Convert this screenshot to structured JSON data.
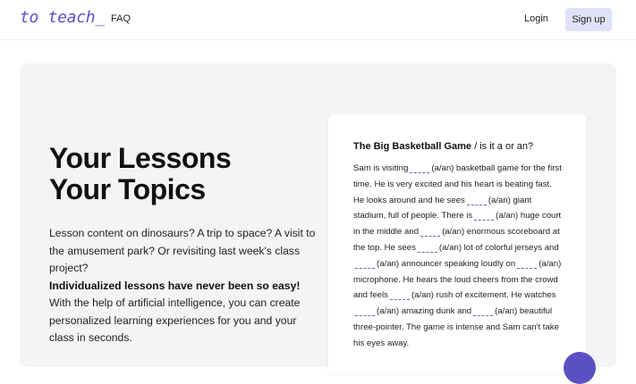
{
  "nav": {
    "logo": "to teach_",
    "faq": "FAQ",
    "login": "Login",
    "signup": "Sign up"
  },
  "hero": {
    "title_line1": "Your Lessons",
    "title_line2": "Your Topics",
    "desc_intro": "Lesson content on dinosaurs? A trip to space? A visit to the amusement park? Or revisiting last week's class project?",
    "desc_bold": "Individualized lessons have never been so easy!",
    "desc_rest": "With the help of artificial intelligence, you can create personalized learning experiences for you and your class in seconds."
  },
  "exercise": {
    "title": "The Big Basketball Game",
    "subtitle": "/ is it a or an?",
    "segments": [
      "Sam is visiting",
      "(a/an) basketball game for the first time. He is very excited and his heart is beating fast. He looks around and he sees",
      "(a/an) giant stadium, full of people. There is",
      "(a/an) huge court in the middle and",
      "(a/an) enormous scoreboard at the top. He sees",
      "(a/an) lot of colorful jerseys and",
      "(a/an) announcer speaking loudly on",
      "(a/an) microphone. He hears the loud cheers from the crowd and feels",
      "(a/an) rush of excitement. He watches",
      "(a/an) amazing dunk and",
      "(a/an) beautiful three-pointer. The game is intense and Sam can't take his eyes away."
    ]
  },
  "colors": {
    "accent": "#5b4fc4",
    "highlight": "#b9c1f2",
    "signup_bg": "#dfe2f7",
    "hero_bg": "#f3f4f6"
  }
}
